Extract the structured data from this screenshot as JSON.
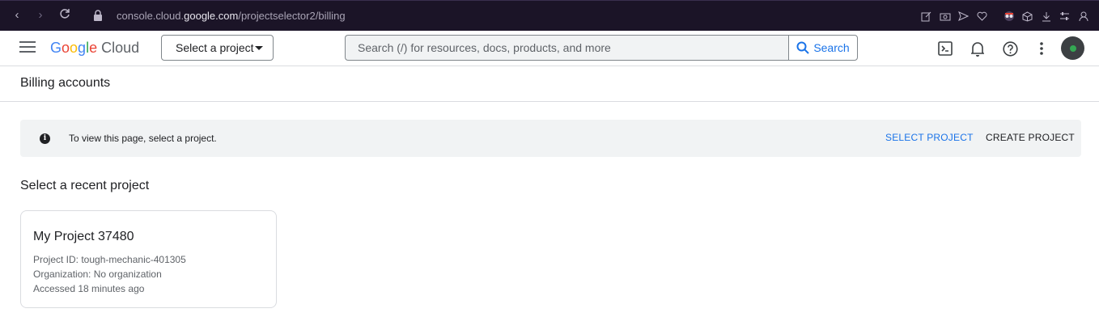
{
  "browser": {
    "url_prefix": "console.cloud.",
    "url_domain": "google.com",
    "url_path": "/projectselector2/billing"
  },
  "header": {
    "logo_google": [
      "G",
      "o",
      "o",
      "g",
      "l",
      "e"
    ],
    "logo_cloud": "Cloud",
    "project_select_label": "Select a project",
    "search_placeholder": "Search (/) for resources, docs, products, and more",
    "search_button_label": "Search"
  },
  "page": {
    "title": "Billing accounts",
    "banner_text": "To view this page, select a project.",
    "select_project_label": "SELECT PROJECT",
    "create_project_label": "CREATE PROJECT",
    "recent_heading": "Select a recent project"
  },
  "recent_projects": [
    {
      "name": "My Project 37480",
      "project_id": "Project ID: tough-mechanic-401305",
      "organization": "Organization: No organization",
      "accessed": "Accessed 18 minutes ago"
    }
  ],
  "icons": {
    "info": "i"
  },
  "colors": {
    "accent": "#1a73e8",
    "browser_bg": "#1b1427",
    "banner_bg": "#f1f3f4"
  }
}
